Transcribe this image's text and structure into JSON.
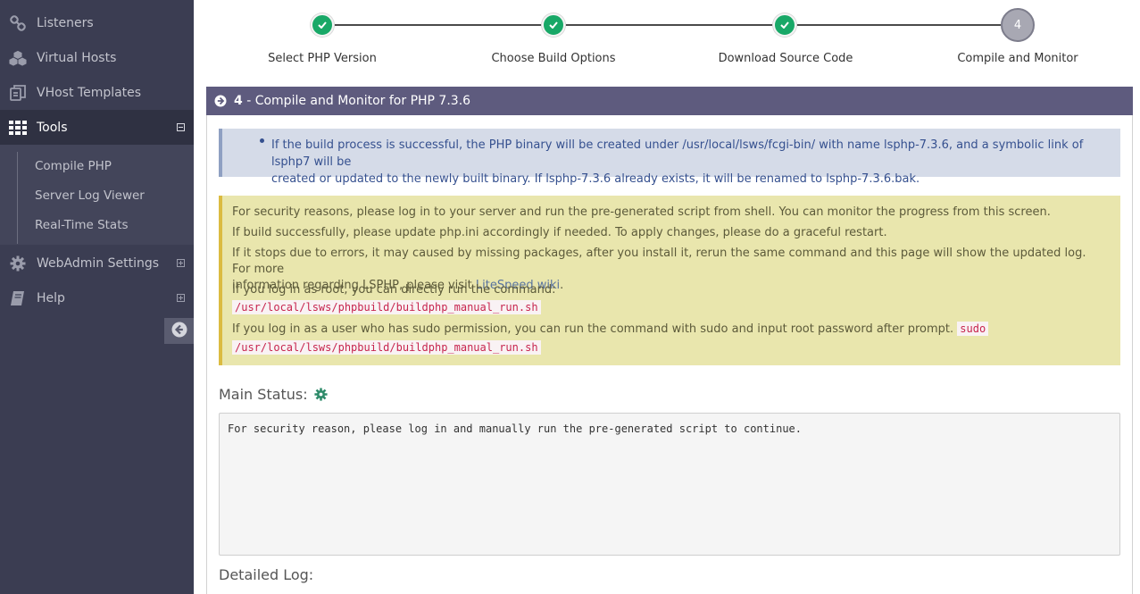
{
  "sidebar": {
    "items": [
      {
        "label": "Listeners",
        "icon": "link-icon"
      },
      {
        "label": "Virtual Hosts",
        "icon": "cubes-icon"
      },
      {
        "label": "VHost Templates",
        "icon": "copy-icon"
      },
      {
        "label": "Tools",
        "icon": "grid-icon",
        "toggle": "⊟",
        "active": true
      },
      {
        "label": "WebAdmin Settings",
        "icon": "gear-icon",
        "toggle": "⊞"
      },
      {
        "label": "Help",
        "icon": "book-icon",
        "toggle": "⊞"
      }
    ],
    "tools_subitems": [
      "Compile PHP",
      "Server Log Viewer",
      "Real-Time Stats"
    ]
  },
  "stepper": {
    "steps": [
      {
        "label": "Select PHP Version",
        "state": "done"
      },
      {
        "label": "Choose Build Options",
        "state": "done"
      },
      {
        "label": "Download Source Code",
        "state": "done"
      },
      {
        "label": "Compile and Monitor",
        "state": "current",
        "number": "4"
      }
    ]
  },
  "panel": {
    "step_number": "4",
    "title_rest": " - Compile and Monitor for PHP 7.3.6",
    "info_line1": "If the build process is successful, the PHP binary will be created under /usr/local/lsws/fcgi-bin/ with name lsphp-7.3.6, and a symbolic link of lsphp7 will be",
    "info_line2": "created or updated to the newly built binary. If lsphp-7.3.6 already exists, it will be renamed to lsphp-7.3.6.bak.",
    "warn_p1": "For security reasons, please log in to your server and run the pre-generated script from shell. You can monitor the progress from this screen.",
    "warn_p2": "If build successfully, please update php.ini accordingly if needed. To apply changes, please do a graceful restart.",
    "warn_p3a": "If it stops due to errors, it may caused by missing packages, after you install it, rerun the same command and this page will show the updated log. For more",
    "warn_p3b": "information regarding LSPHP, please visit ",
    "warn_p3_link": "LiteSpeed wiki",
    "warn_p3_end": ".",
    "warn_p4": "If you log in as root, you can directly run the command:",
    "root_command": "/usr/local/lsws/phpbuild/buildphp_manual_run.sh",
    "warn_p5": "If you log in as a user who has sudo permission, you can run the command with sudo and input root password after prompt.",
    "sudo_word": "sudo",
    "sudo_command": "/usr/local/lsws/phpbuild/buildphp_manual_run.sh",
    "main_status_label": "Main Status:",
    "main_status_text": "For security reason, please log in and manually run the pre-generated script to continue.",
    "detailed_log_label": "Detailed Log:"
  },
  "colors": {
    "sidebar_bg": "#3b3d52",
    "panel_header": "#5e5b7e",
    "step_done": "#18a867",
    "info_bg": "#d5dbe8",
    "warn_bg": "#e9e6ad"
  }
}
